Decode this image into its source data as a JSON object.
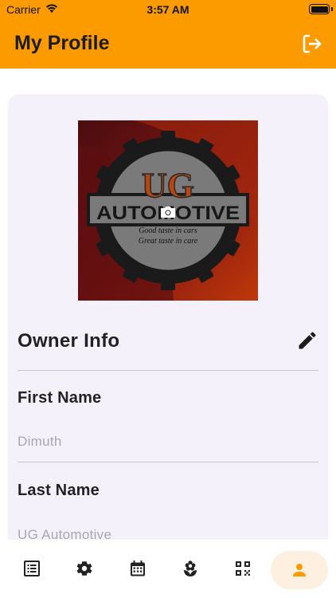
{
  "status_bar": {
    "carrier": "Carrier",
    "time": "3:57 AM",
    "icons": [
      "wifi-icon",
      "battery-icon"
    ]
  },
  "app_bar": {
    "title": "My Profile",
    "action_icon": "logout-icon"
  },
  "profile": {
    "logo": {
      "brand_text_top": "UG",
      "brand_text_main": "AUTOMOTIVE",
      "tagline_1": "Good taste in cars",
      "tagline_2": "Great taste in care"
    },
    "camera_icon": "camera-icon"
  },
  "owner_info": {
    "heading": "Owner Info",
    "edit_icon": "pencil-icon",
    "fields": [
      {
        "label": "First Name",
        "value": "Dimuth"
      },
      {
        "label": "Last Name",
        "value": "UG Automotive"
      }
    ]
  },
  "bottom_nav": {
    "items": [
      {
        "icon": "list-icon",
        "active": false
      },
      {
        "icon": "gear-icon",
        "active": false
      },
      {
        "icon": "calendar-icon",
        "active": false
      },
      {
        "icon": "flower-icon",
        "active": false
      },
      {
        "icon": "qr-code-icon",
        "active": false
      },
      {
        "icon": "person-icon",
        "active": true
      }
    ],
    "accent_color": "#fb9b00"
  },
  "colors": {
    "brand": "#fb9b00",
    "card_bg": "#f4f1fa",
    "placeholder_text": "#a9a6ad"
  }
}
